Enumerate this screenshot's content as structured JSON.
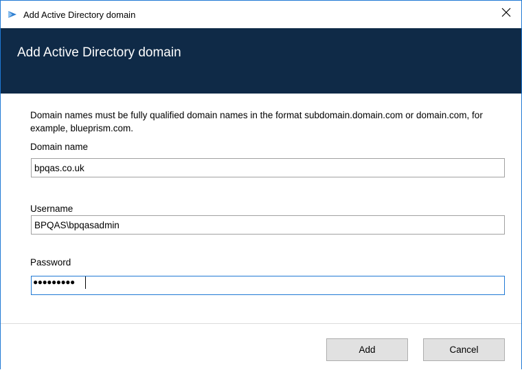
{
  "window": {
    "title": "Add Active Directory domain",
    "close_glyph": "✕",
    "accent_color": "#1e78d4",
    "header_color": "#0f2a47"
  },
  "header": {
    "title": "Add Active Directory domain"
  },
  "form": {
    "description": "Domain names must be fully qualified domain names in the format subdomain.domain.com or domain.com, for example, blueprism.com.",
    "domain_name": {
      "label": "Domain name",
      "value": "bpqas.co.uk"
    },
    "username": {
      "label": "Username",
      "value": "BPQAS\\bpqasadmin"
    },
    "password": {
      "label": "Password",
      "masked_value": "●●●●●●●●●"
    }
  },
  "footer": {
    "add_label": "Add",
    "cancel_label": "Cancel"
  },
  "icons": {
    "app_icon": "app-icon",
    "close_icon": "close-icon"
  }
}
